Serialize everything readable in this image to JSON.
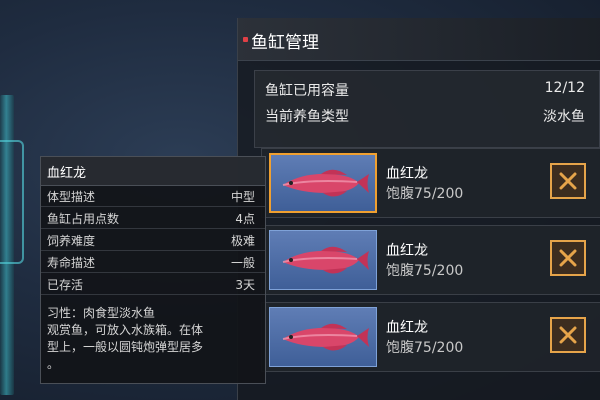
{
  "panel": {
    "title": "鱼缸管理",
    "capacity_label": "鱼缸已用容量",
    "capacity_value": "12/12",
    "type_label": "当前养鱼类型",
    "type_value": "淡水鱼"
  },
  "fish": [
    {
      "name": "血红龙",
      "hunger": "饱腹75/200",
      "selected": true
    },
    {
      "name": "血红龙",
      "hunger": "饱腹75/200",
      "selected": false
    },
    {
      "name": "血红龙",
      "hunger": "饱腹75/200",
      "selected": false
    }
  ],
  "tooltip": {
    "title": "血红龙",
    "rows": [
      {
        "label": "体型描述",
        "value": "中型"
      },
      {
        "label": "鱼缸占用点数",
        "value": "4点"
      },
      {
        "label": "饲养难度",
        "value": "极难"
      },
      {
        "label": "寿命描述",
        "value": "一般"
      },
      {
        "label": "已存活",
        "value": "3天"
      }
    ],
    "description_lines": [
      "习性：肉食型淡水鱼",
      "观赏鱼，可放入水族箱。在体",
      "型上，一般以圆钝炮弹型居多",
      "。"
    ]
  },
  "colors": {
    "accent_orange": "#e6a44a",
    "fish_red": "#d9466a",
    "header_dot": "#e04046"
  },
  "icons": {
    "remove": "close-icon",
    "fish": "arowana-fish-icon"
  }
}
